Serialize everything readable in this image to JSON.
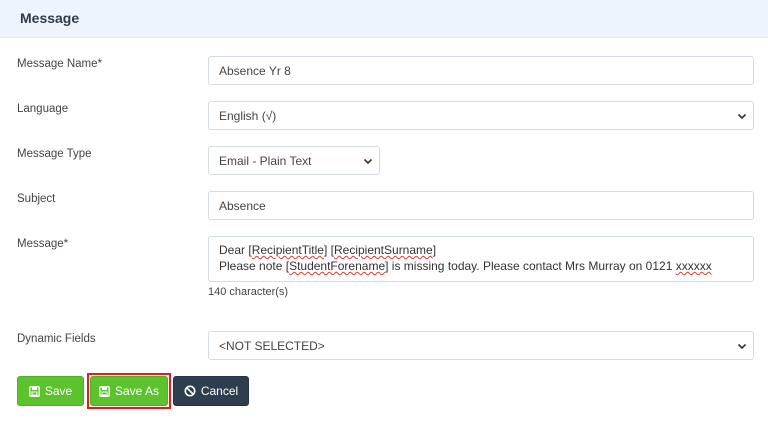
{
  "panel": {
    "title": "Message"
  },
  "form": {
    "message_name": {
      "label": "Message Name*",
      "value": "Absence Yr 8"
    },
    "language": {
      "label": "Language",
      "value": "English (√)"
    },
    "message_type": {
      "label": "Message Type",
      "value": "Email - Plain Text"
    },
    "subject": {
      "label": "Subject",
      "value": "Absence"
    },
    "message": {
      "label": "Message*",
      "line1": {
        "p1": "Dear ",
        "t1": "RecipientTitle",
        "p2": " ",
        "t2": "RecipientSurname"
      },
      "line2": {
        "p1": "Please note ",
        "t1": "StudentForename",
        "p2": " is missing today. Please contact Mrs Murray on 0121 ",
        "t2": "xxxxxx"
      },
      "char_count": "140 character(s)"
    },
    "dynamic_fields": {
      "label": "Dynamic Fields",
      "value": "<NOT SELECTED>"
    }
  },
  "buttons": {
    "save": "Save",
    "save_as": "Save As",
    "cancel": "Cancel"
  },
  "colors": {
    "header_bg": "#eef4fc",
    "save_green": "#5cc22e",
    "cancel_dark": "#2f3e4f",
    "highlight_red": "#e01e1e"
  },
  "icons": {
    "save": "floppy-disk-icon",
    "cancel": "ban-icon",
    "dropdown": "chevron-down-icon"
  }
}
